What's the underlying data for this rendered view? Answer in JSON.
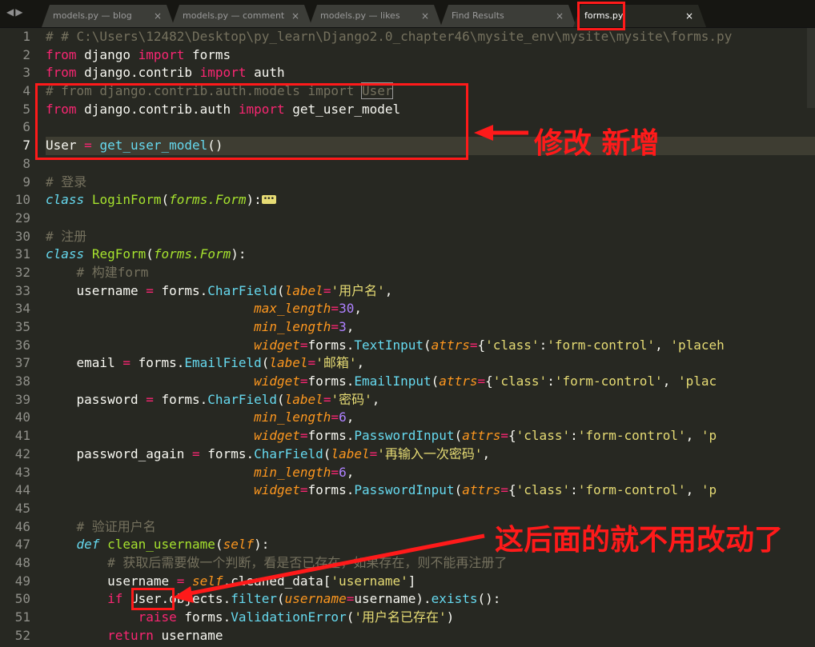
{
  "tabs": {
    "nav": "◀▶",
    "items": [
      {
        "label": "models.py — blog",
        "close": "×"
      },
      {
        "label": "models.py — comment",
        "close": "×"
      },
      {
        "label": "models.py — likes",
        "close": "×"
      },
      {
        "label": "Find Results",
        "close": "×"
      },
      {
        "label": "forms.py",
        "close": "×"
      }
    ]
  },
  "line_numbers": [
    "1",
    "2",
    "3",
    "4",
    "5",
    "6",
    "7",
    "8",
    "9",
    "10",
    "29",
    "30",
    "31",
    "32",
    "33",
    "34",
    "35",
    "36",
    "37",
    "38",
    "39",
    "40",
    "41",
    "42",
    "43",
    "44",
    "45",
    "46",
    "47",
    "48",
    "49",
    "50",
    "51",
    "52"
  ],
  "code": {
    "l1": "# # C:\\Users\\12482\\Desktop\\py_learn\\Django2.0_chapter46\\mysite_env\\mysite\\mysite\\forms.py",
    "l2": {
      "a": "from",
      "b": " django ",
      "c": "import",
      "d": " forms"
    },
    "l3": {
      "a": "from",
      "b": " django.contrib ",
      "c": "import",
      "d": " auth"
    },
    "l4": {
      "a": "# from django.contrib.auth.models import ",
      "b": "User"
    },
    "l5": {
      "a": "from",
      "b": " django.contrib.auth ",
      "c": "import",
      "d": " get_user_model"
    },
    "l7": {
      "a": "User",
      "b": " = ",
      "c": "get_user_model",
      "d": "()"
    },
    "l9": "# 登录",
    "l10": {
      "a": "class",
      "b": " ",
      "c": "LoginForm",
      "d": "(",
      "e": "forms.Form",
      "f": "):"
    },
    "l30": "# 注册",
    "l31": {
      "a": "class",
      "b": " ",
      "c": "RegForm",
      "d": "(",
      "e": "forms.Form",
      "f": "):"
    },
    "l32": "# 构建form",
    "l33": {
      "a": "username",
      "b": " = ",
      "c": "forms.",
      "d": "CharField",
      "e": "(",
      "f": "label",
      "g": "=",
      "h": "'用户名'",
      "i": ","
    },
    "l34": {
      "a": "max_length",
      "b": "=",
      "c": "30",
      "d": ","
    },
    "l35": {
      "a": "min_length",
      "b": "=",
      "c": "3",
      "d": ","
    },
    "l36": {
      "a": "widget",
      "b": "=",
      "c": "forms.",
      "d": "TextInput",
      "e": "(",
      "f": "attrs",
      "g": "=",
      "h": "{",
      "i": "'class'",
      "j": ":",
      "k": "'form-control'",
      "l": ", ",
      "m": "'placeh"
    },
    "l37": {
      "a": "email",
      "b": " = ",
      "c": "forms.",
      "d": "EmailField",
      "e": "(",
      "f": "label",
      "g": "=",
      "h": "'邮箱'",
      "i": ","
    },
    "l38": {
      "a": "widget",
      "b": "=",
      "c": "forms.",
      "d": "EmailInput",
      "e": "(",
      "f": "attrs",
      "g": "=",
      "h": "{",
      "i": "'class'",
      "j": ":",
      "k": "'form-control'",
      "l": ", ",
      "m": "'plac"
    },
    "l39": {
      "a": "password",
      "b": " = ",
      "c": "forms.",
      "d": "CharField",
      "e": "(",
      "f": "label",
      "g": "=",
      "h": "'密码'",
      "i": ","
    },
    "l40": {
      "a": "min_length",
      "b": "=",
      "c": "6",
      "d": ","
    },
    "l41": {
      "a": "widget",
      "b": "=",
      "c": "forms.",
      "d": "PasswordInput",
      "e": "(",
      "f": "attrs",
      "g": "=",
      "h": "{",
      "i": "'class'",
      "j": ":",
      "k": "'form-control'",
      "l": ", ",
      "m": "'p"
    },
    "l42": {
      "a": "password_again",
      "b": " = ",
      "c": "forms.",
      "d": "CharField",
      "e": "(",
      "f": "label",
      "g": "=",
      "h": "'再输入一次密码'",
      "i": ","
    },
    "l43": {
      "a": "min_length",
      "b": "=",
      "c": "6",
      "d": ","
    },
    "l44": {
      "a": "widget",
      "b": "=",
      "c": "forms.",
      "d": "PasswordInput",
      "e": "(",
      "f": "attrs",
      "g": "=",
      "h": "{",
      "i": "'class'",
      "j": ":",
      "k": "'form-control'",
      "l": ", ",
      "m": "'p"
    },
    "l46": "# 验证用户名",
    "l47": {
      "a": "def",
      "b": " ",
      "c": "clean_username",
      "d": "(",
      "e": "self",
      "f": "):"
    },
    "l48": "# 获取后需要做一个判断，看是否已存在，如果存在，则不能再注册了",
    "l49": {
      "a": "username",
      "b": " = ",
      "c": "self",
      "d": ".cleaned_data[",
      "e": "'username'",
      "f": "]"
    },
    "l50": {
      "a": "if",
      "b": " ",
      "c": "User",
      "d": ".objects.",
      "e": "filter",
      "f": "(",
      "g": "username",
      "h": "=",
      "i": "username).",
      "j": "exists",
      "k": "():"
    },
    "l51": {
      "a": "raise",
      "b": " forms.",
      "c": "ValidationError",
      "d": "(",
      "e": "'用户名已存在'",
      "f": ")"
    },
    "l52": {
      "a": "return",
      "b": " username"
    }
  },
  "annotations": {
    "top": "修改 新增",
    "bottom": "这后面的就不用改动了"
  },
  "colors": {
    "annotation": "#ff1a1a",
    "background": "#272822"
  }
}
